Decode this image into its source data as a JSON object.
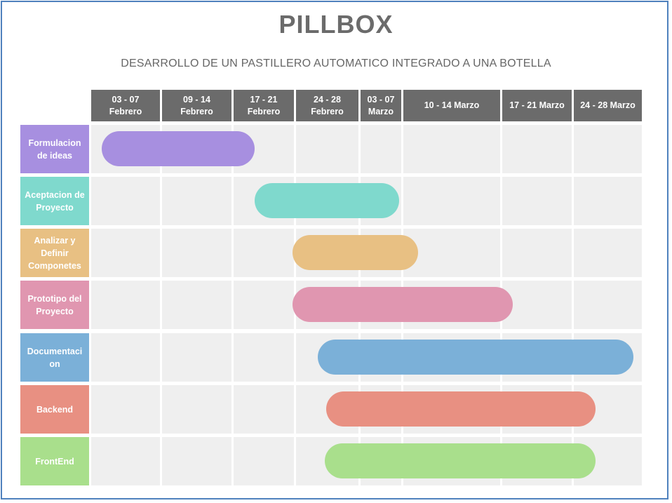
{
  "title": "PILLBOX",
  "subtitle": "DESARROLLO  DE  UN PASTILLERO AUTOMATICO INTEGRADO A UNA BOTELLA",
  "columns": [
    {
      "label": "03 - 07\nFebrero"
    },
    {
      "label": "09 - 14\nFebrero"
    },
    {
      "label": "17 - 21\nFebrero"
    },
    {
      "label": "24 - 28\nFebrero"
    },
    {
      "label": "03 - 07\nMarzo"
    },
    {
      "label": "10 - 14 Marzo"
    },
    {
      "label": "17 - 21 Marzo"
    },
    {
      "label": "24 -  28 Marzo"
    }
  ],
  "tasks": [
    {
      "label": "Formulacion\nde ideas",
      "color": "#a78fe0",
      "start": 0.15,
      "end": 2.35
    },
    {
      "label": "Aceptacion de\nProyecto",
      "color": "#7fd9cd",
      "start": 2.35,
      "end": 4.95
    },
    {
      "label": "Analizar y\nDefinir\nComponetes",
      "color": "#e8c083",
      "start": 2.98,
      "end": 5.15
    },
    {
      "label": "Prototipo del\nProyecto",
      "color": "#e096b0",
      "start": 2.98,
      "end": 6.15
    },
    {
      "label": "Documentaci\non",
      "color": "#7bb0d8",
      "start": 3.35,
      "end": 7.88
    },
    {
      "label": "Backend",
      "color": "#e89082",
      "start": 3.48,
      "end": 7.32
    },
    {
      "label": "FrontEnd",
      "color": "#a9df8c",
      "start": 3.46,
      "end": 7.32
    }
  ]
}
